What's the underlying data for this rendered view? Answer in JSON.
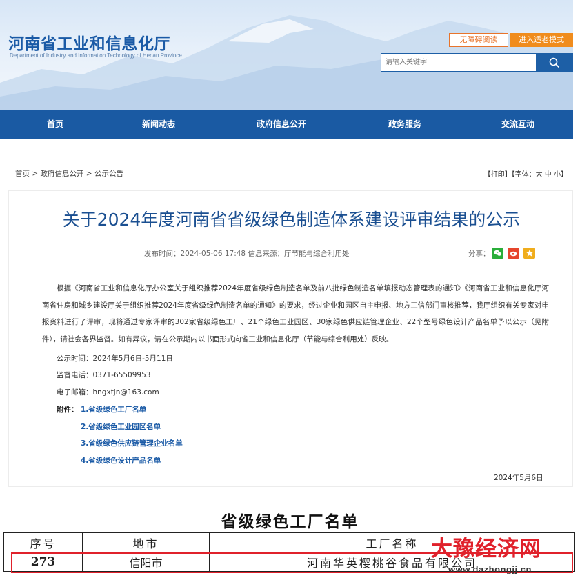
{
  "site": {
    "title": "河南省工业和信息化厅",
    "subtitle": "Department of Industry and Information Technology of Henan Province",
    "accessible_label": "无障碍阅读",
    "elderly_label": "进入适老模式",
    "search_placeholder": "请输入关键字",
    "brand_color": "#1a5aa3"
  },
  "nav": [
    "首页",
    "新闻动态",
    "政府信息公开",
    "政务服务",
    "交流互动"
  ],
  "breadcrumb": "首页 > 政府信息公开 > 公示公告",
  "tools": "【打印】【字体：大 中 小】",
  "article": {
    "title": "关于2024年度河南省省级绿色制造体系建设评审结果的公示",
    "meta": "发布时间：2024-05-06 17:48   信息来源：厅节能与综合利用处",
    "share_label": "分享：",
    "body": "根据《河南省工业和信息化厅办公室关于组织推荐2024年度省级绿色制造名单及前八批绿色制造名单填报动态管理表的通知》《河南省工业和信息化厅河南省住房和城乡建设厅关于组织推荐2024年度省级绿色制造名单的通知》的要求，经过企业和园区自主申报、地方工信部门审核推荐，我厅组织有关专家对申报资料进行了评审，现将通过专家评审的302家省级绿色工厂、21个绿色工业园区、30家绿色供应链管理企业、22个型号绿色设计产品名单予以公示（见附件），请社会各界监督。如有异议，请在公示期内以书面形式向省工业和信息化厅（节能与综合利用处）反映。",
    "period": "公示时间：2024年5月6日-5月11日",
    "phone": "监督电话：0371-65509953",
    "email": "电子邮箱：hngxtjn@163.com",
    "attach_label": "附件：",
    "attachments": [
      "1.省级绿色工厂名单",
      "2.省级绿色工业园区名单",
      "3.省级绿色供应链管理企业名单",
      "4.省级绿色设计产品名单"
    ],
    "date": "2024年5月6日"
  },
  "factory_list": {
    "title": "省级绿色工厂名单",
    "headers": [
      "序号",
      "地市",
      "工厂名称"
    ],
    "row": [
      "273",
      "信阳市",
      "河南华英樱桃谷食品有限公司"
    ]
  },
  "watermark": {
    "name": "大豫经济网",
    "url": "www.dazhongjj.cn"
  },
  "icons": [
    "search-icon",
    "wechat-icon",
    "weibo-icon",
    "favorite-icon"
  ]
}
